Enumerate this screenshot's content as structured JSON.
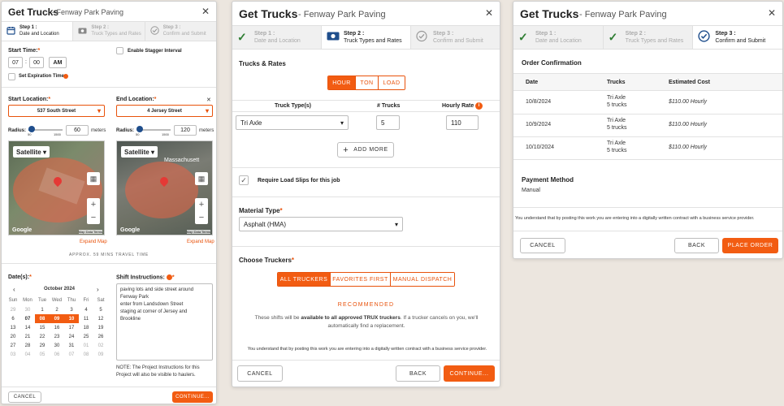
{
  "app": {
    "title": "Get Trucks",
    "subtitle": "- Fenway Park Paving"
  },
  "steps": [
    {
      "n": "Step 1 :",
      "label": "Date and Location"
    },
    {
      "n": "Step 2 :",
      "label": "Truck Types and Rates"
    },
    {
      "n": "Step 3 :",
      "label": "Confirm and Submit"
    }
  ],
  "step1": {
    "start_time_label": "Start Time:",
    "hour": "07",
    "minute": "00",
    "ampm": "AM",
    "stagger_label": "Enable Stagger Interval",
    "expiration_label": "Set Expiration Time",
    "start_location_label": "Start Location:",
    "start_location": "537 South Street",
    "end_location_label": "End Location:",
    "end_location": "4 Jersey Street",
    "radius_label": "Radius:",
    "radius_min": "50",
    "radius_max": "1500",
    "start_radius": "60",
    "end_radius": "120",
    "meters": "meters",
    "map_type": "Satellite",
    "map_place": "Massachusett",
    "map_logo": "Google",
    "map_credits": "Map Data   Terms",
    "expand_map": "Expand Map",
    "travel_time": "APPROX. 59 MINS TRAVEL TIME",
    "dates_label": "Date(s):",
    "month": "October 2024",
    "weekdays": [
      "Sun",
      "Mon",
      "Tue",
      "Wed",
      "Thu",
      "Fri",
      "Sat"
    ],
    "weeks": [
      [
        "29",
        "30",
        "1",
        "2",
        "3",
        "4",
        "5"
      ],
      [
        "6",
        "07",
        "08",
        "09",
        "10",
        "11",
        "12"
      ],
      [
        "13",
        "14",
        "15",
        "16",
        "17",
        "18",
        "19"
      ],
      [
        "20",
        "21",
        "22",
        "23",
        "24",
        "25",
        "26"
      ],
      [
        "27",
        "28",
        "29",
        "30",
        "31",
        "01",
        "02"
      ],
      [
        "03",
        "04",
        "05",
        "06",
        "07",
        "08",
        "09"
      ]
    ],
    "shift_label": "Shift Instructions:",
    "shift_text": "paving lots and side street around Fenway Park\nenter from Landsdown Street\nstaging at corner of Jersey and Brookline",
    "note": "NOTE: The Project Instructions for this Project will also be visible to haulers.",
    "cancel": "CANCEL",
    "continue": "CONTINUE..."
  },
  "step2": {
    "rates_title": "Trucks & Rates",
    "rate_types": [
      "HOUR",
      "TON",
      "LOAD"
    ],
    "col_type": "Truck Type(s)",
    "col_trucks": "# Trucks",
    "col_rate": "Hourly Rate",
    "truck_type": "Tri Axle",
    "trucks": "5",
    "rate": "110",
    "add_more": "ADD MORE",
    "load_slips": "Require Load Slips for this job",
    "material_label": "Material Type",
    "material": "Asphalt (HMA)",
    "choose_label": "Choose Truckers",
    "trucker_options": [
      "ALL TRUCKERS",
      "FAVORITES FIRST",
      "MANUAL DISPATCH"
    ],
    "recommended": "RECOMMENDED",
    "info_a": "These shifts will be ",
    "info_b": "available to all approved TRUX truckers",
    "info_c": ". If a trucker cancels on you, we'll automatically find a replacement.",
    "contract": "You understand that by posting this work you are entering into a digitally written contract with a business service provider.",
    "cancel": "CANCEL",
    "back": "BACK",
    "continue": "CONTINUE..."
  },
  "step3": {
    "title": "Order Confirmation",
    "cols": [
      "Date",
      "Trucks",
      "Estimated Cost"
    ],
    "rows": [
      {
        "date": "10/8/2024",
        "truck": "Tri Axle",
        "count": "5 trucks",
        "cost": "$110.00 Hourly"
      },
      {
        "date": "10/9/2024",
        "truck": "Tri Axle",
        "count": "5 trucks",
        "cost": "$110.00 Hourly"
      },
      {
        "date": "10/10/2024",
        "truck": "Tri Axle",
        "count": "5 trucks",
        "cost": "$110.00 Hourly"
      }
    ],
    "payment_title": "Payment Method",
    "payment": "Manual",
    "contract": "You understand that by posting this work you are entering into a digitally written contract with a business service provider.",
    "cancel": "CANCEL",
    "back": "BACK",
    "place_order": "PLACE ORDER"
  },
  "colors": {
    "accent": "#f25c12",
    "check": "#2e7d32",
    "step_icon": "#1f4e8c"
  }
}
